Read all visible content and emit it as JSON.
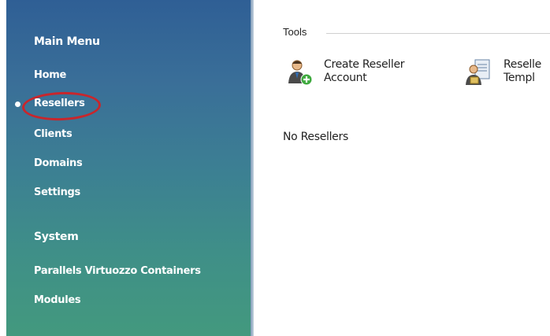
{
  "sidebar": {
    "main_menu_heading": "Main Menu",
    "items": [
      {
        "label": "Home"
      },
      {
        "label": "Resellers",
        "selected": true
      },
      {
        "label": "Clients"
      },
      {
        "label": "Domains"
      },
      {
        "label": "Settings"
      }
    ],
    "system_heading": "System",
    "system_items": [
      {
        "label": "Parallels Virtuozzo Containers"
      },
      {
        "label": "Modules"
      }
    ],
    "highlight_color": "#c8262c"
  },
  "main": {
    "tools_label": "Tools",
    "tools": [
      {
        "label": "Create Reseller\nAccount",
        "icon": "create-reseller-icon"
      },
      {
        "label": "Reselle\nTempl",
        "icon": "reseller-template-icon"
      }
    ],
    "empty_message": "No Resellers"
  }
}
